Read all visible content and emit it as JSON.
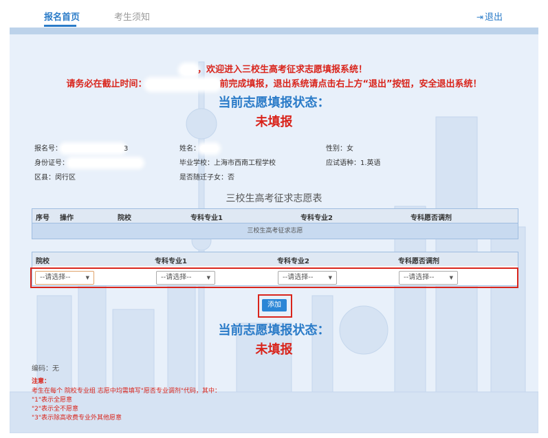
{
  "nav": {
    "tab_home": "报名首页",
    "tab_notice": "考生须知",
    "logout": "退出"
  },
  "banner": {
    "welcome_suffix": "，欢迎进入三校生高考征求志愿填报系统！",
    "deadline_prefix": "请务必在截止时间：",
    "deadline_suffix": "前完成填报，退出系统请点击右上方“退出”按钮，安全退出系统！"
  },
  "status": {
    "title": "当前志愿填报状态：",
    "value": "未填报"
  },
  "profile": {
    "reg_no_label": "报名号：",
    "reg_no_tail": "3",
    "name_label": "姓名：",
    "gender_label": "性别：",
    "gender": "女",
    "id_label": "身份证号：",
    "school_label": "毕业学校：",
    "school": "上海市西南工程学校",
    "language_label": "应试语种：",
    "language": "1.英语",
    "district_label": "区县：",
    "district": "闵行区",
    "migrant_label": "是否随迁子女：",
    "migrant": "否"
  },
  "wish_table": {
    "title": "三校生高考征求志愿表",
    "headers": [
      "序号",
      "操作",
      "院校",
      "专科专业1",
      "专科专业2",
      "专科愿否调剂"
    ],
    "subtitle": "三校生高考征求志愿"
  },
  "entry_form": {
    "headers": [
      "院校",
      "专科专业1",
      "专科专业2",
      "专科愿否调剂"
    ],
    "select_placeholder": "--请选择--",
    "add_button": "添加"
  },
  "footer": {
    "code_label": "编码：",
    "code_value": "无",
    "notes_title": "注意：",
    "notes": [
      "考生在每个 院校专业组 志愿中均需填写\"愿否专业调剂\"代码，其中：",
      "\"1\"表示全愿意",
      "\"2\"表示全不愿意",
      "\"3\"表示除高收费专业外其他愿意"
    ]
  },
  "colors": {
    "accent_blue": "#2a7bc8",
    "alert_red": "#d9241b",
    "panel_bg": "#e8f0fa"
  }
}
